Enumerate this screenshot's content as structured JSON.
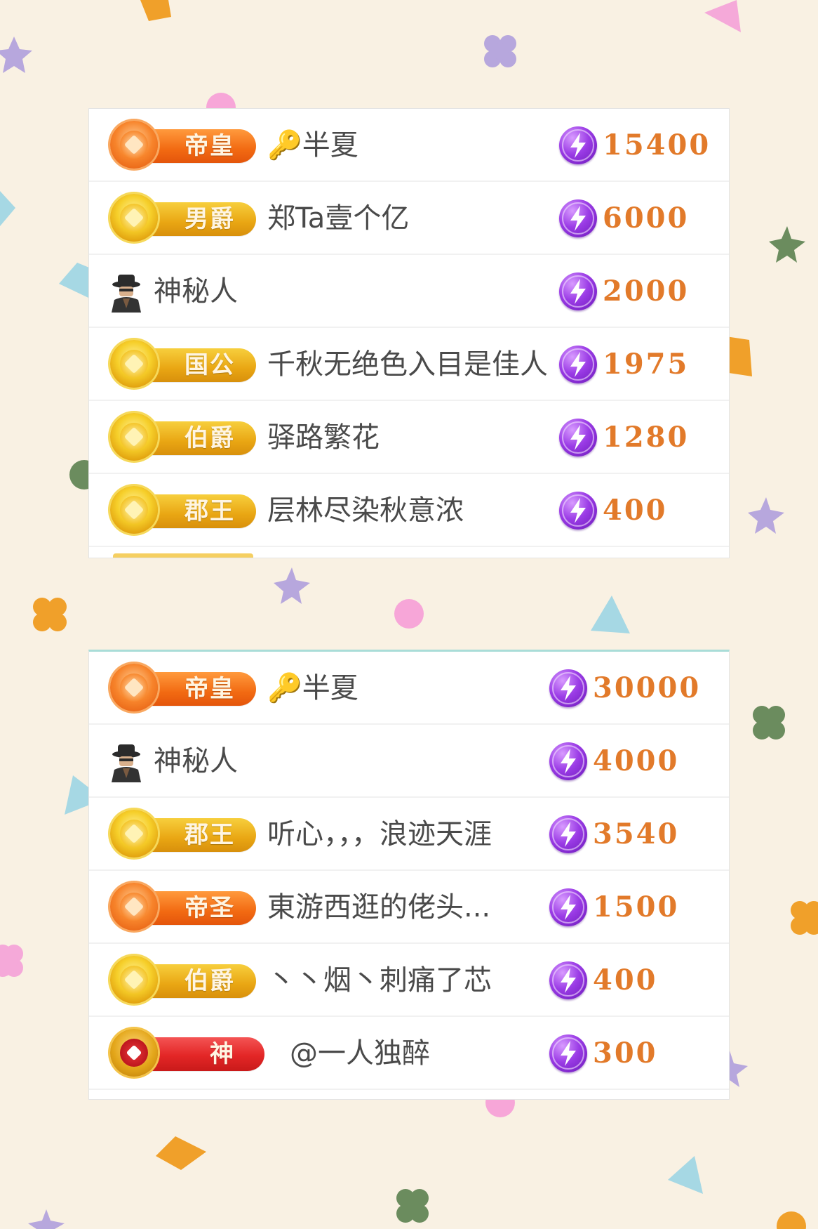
{
  "colors": {
    "background": "#f9f1e3",
    "score": "#e27a2a",
    "bolt_icon": "#8a2be2",
    "name_text": "#4a4a4a"
  },
  "leaderboard_top": [
    {
      "badge": "帝皇",
      "badge_style": "orange",
      "icon": "emblem-icon",
      "name": "🔑半夏",
      "score": "15400"
    },
    {
      "badge": "男爵",
      "badge_style": "gold",
      "icon": "emblem-icon",
      "name": "郑Ta壹个亿",
      "score": "6000"
    },
    {
      "badge": "",
      "badge_style": "none",
      "icon": "mystery-avatar-icon",
      "name": "神秘人",
      "score": "2000"
    },
    {
      "badge": "国公",
      "badge_style": "gold",
      "icon": "emblem-icon",
      "name": "千秋无绝色入目是佳人",
      "score": "1975"
    },
    {
      "badge": "伯爵",
      "badge_style": "gold",
      "icon": "emblem-icon",
      "name": "驿路繁花",
      "score": "1280"
    },
    {
      "badge": "郡王",
      "badge_style": "gold",
      "icon": "emblem-icon",
      "name": "层林尽染秋意浓",
      "score": "400"
    }
  ],
  "leaderboard_bottom": [
    {
      "badge": "帝皇",
      "badge_style": "orange",
      "icon": "emblem-icon",
      "name": "🔑半夏",
      "score": "30000"
    },
    {
      "badge": "",
      "badge_style": "none",
      "icon": "mystery-avatar-icon",
      "name": "神秘人",
      "score": "4000"
    },
    {
      "badge": "郡王",
      "badge_style": "gold",
      "icon": "emblem-icon",
      "name": "听心，，，浪迹天涯",
      "score": "3540"
    },
    {
      "badge": "帝圣",
      "badge_style": "orange",
      "icon": "emblem-icon",
      "name": "東游西逛的佬头...",
      "score": "1500"
    },
    {
      "badge": "伯爵",
      "badge_style": "gold",
      "icon": "emblem-icon",
      "name": "丶丶烟丶刺痛了芯",
      "score": "400"
    },
    {
      "badge": "神",
      "badge_style": "red",
      "icon": "emblem-icon",
      "name": "@一人独醉",
      "score": "300"
    }
  ]
}
